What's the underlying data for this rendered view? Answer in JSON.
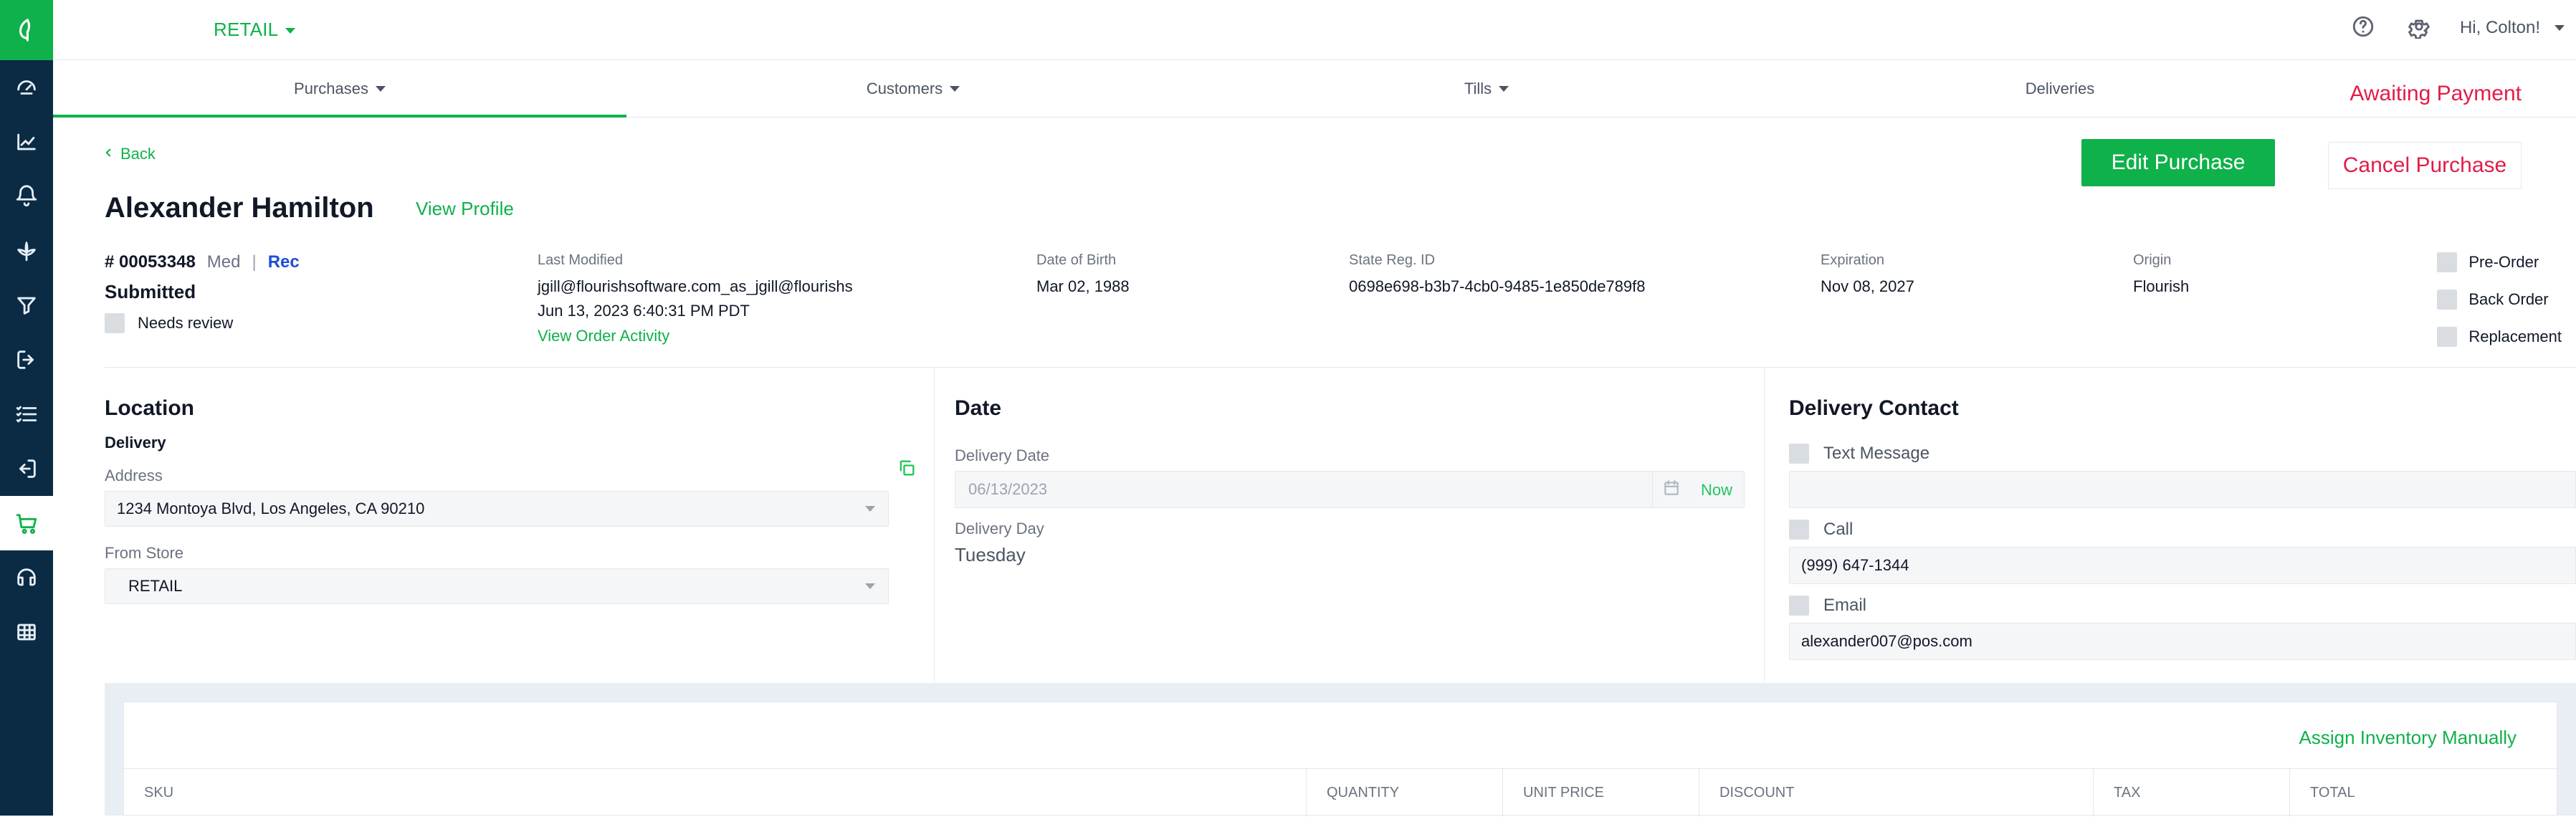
{
  "header": {
    "store_label": "RETAIL",
    "greeting": "Hi, Colton!"
  },
  "subnav": {
    "tabs": [
      {
        "label": "Purchases",
        "has_caret": true,
        "active": true
      },
      {
        "label": "Customers",
        "has_caret": true,
        "active": false
      },
      {
        "label": "Tills",
        "has_caret": true,
        "active": false
      },
      {
        "label": "Deliveries",
        "has_caret": false,
        "active": false
      }
    ],
    "status_right": "Awaiting Payment"
  },
  "page": {
    "back_label": "Back",
    "customer_name": "Alexander Hamilton",
    "view_profile_label": "View Profile",
    "actions": {
      "edit_label": "Edit Purchase",
      "cancel_label": "Cancel Purchase"
    },
    "order": {
      "number": "# 00053348",
      "type_med": "Med",
      "separator": "|",
      "type_rec": "Rec",
      "status": "Submitted",
      "needs_review_label": "Needs review"
    },
    "fields": {
      "last_modified_label": "Last Modified",
      "last_modified_by": "jgill@flourishsoftware.com_as_jgill@flourishs",
      "last_modified_at": "Jun 13, 2023 6:40:31 PM PDT",
      "view_activity_label": "View Order Activity",
      "dob_label": "Date of Birth",
      "dob_value": "Mar 02, 1988",
      "state_reg_label": "State Reg. ID",
      "state_reg_value": "0698e698-b3b7-4cb0-9485-1e850de789f8",
      "expiration_label": "Expiration",
      "expiration_value": "Nov 08, 2027",
      "origin_label": "Origin",
      "origin_value": "Flourish"
    },
    "flags": [
      {
        "label": "Pre-Order"
      },
      {
        "label": "Back Order"
      },
      {
        "label": "Replacement"
      }
    ],
    "location": {
      "title": "Location",
      "delivery_label": "Delivery",
      "address_label": "Address",
      "address_value": "1234 Montoya Blvd, Los Angeles, CA 90210",
      "from_store_label": "From Store",
      "from_store_value": "RETAIL"
    },
    "date": {
      "title": "Date",
      "delivery_date_label": "Delivery Date",
      "delivery_date_value": "06/13/2023",
      "now_label": "Now",
      "delivery_day_label": "Delivery Day",
      "delivery_day_value": "Tuesday"
    },
    "delivery_contact": {
      "title": "Delivery Contact",
      "text_message_label": "Text Message",
      "text_message_value": "",
      "call_label": "Call",
      "call_value": "(999) 647-1344",
      "email_label": "Email",
      "email_value": "alexander007@pos.com"
    },
    "inventory": {
      "assign_label": "Assign Inventory Manually",
      "columns": [
        "SKU",
        "QUANTITY",
        "UNIT PRICE",
        "DISCOUNT",
        "TAX",
        "TOTAL"
      ]
    }
  },
  "colors": {
    "brand_green": "#0fb14a",
    "rail_navy": "#0b2a44",
    "alert_red": "#e11d48"
  },
  "icons": {
    "rail": [
      "leaf-logo-icon",
      "dashboard-gauge-icon",
      "line-chart-icon",
      "bell-icon",
      "cannabis-leaf-icon",
      "filter-funnel-icon",
      "import-icon",
      "checklist-icon",
      "export-icon",
      "cart-icon",
      "headset-icon",
      "table-icon"
    ],
    "top": [
      "help-circle-icon",
      "settings-gear-icon",
      "chevron-down-icon"
    ],
    "misc": [
      "copy-icon",
      "calendar-icon"
    ]
  }
}
